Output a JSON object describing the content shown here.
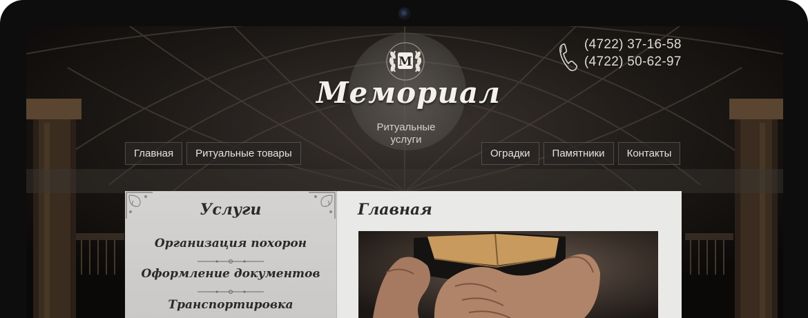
{
  "site": {
    "logo_letter": "М",
    "name": "Мемориал",
    "tagline_line1": "Ритуальные",
    "tagline_line2": "услуги"
  },
  "contacts": {
    "phone1": "(4722) 37-16-58",
    "phone2": "(4722) 50-62-97"
  },
  "nav": {
    "left": [
      "Главная",
      "Ритуальные товары"
    ],
    "right": [
      "Оградки",
      "Памятники",
      "Контакты"
    ]
  },
  "sidebar": {
    "title": "Услуги",
    "items": [
      "Организация похорон",
      "Оформление документов",
      "Транспортировка"
    ]
  },
  "main": {
    "title": "Главная"
  }
}
